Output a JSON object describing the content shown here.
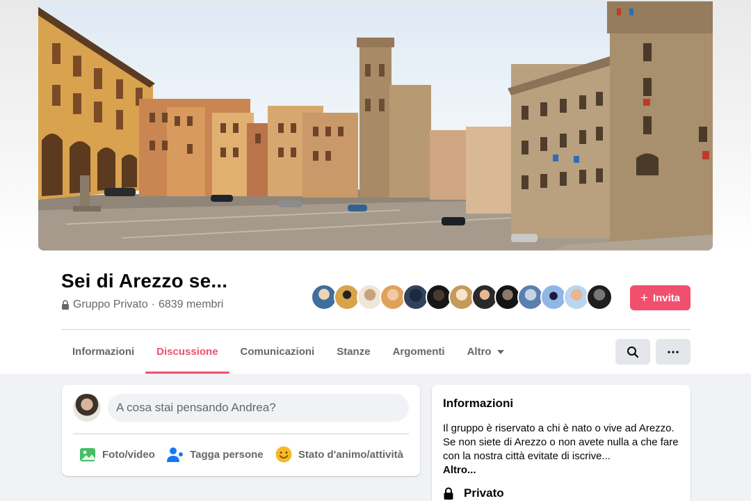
{
  "group": {
    "name": "Sei di Arezzo se...",
    "privacy": "Gruppo Privato",
    "separator": " · ",
    "members": "6839 membri"
  },
  "invite_button": {
    "plus": "+",
    "label": "Invita"
  },
  "tabs": [
    {
      "label": "Informazioni",
      "active": false
    },
    {
      "label": "Discussione",
      "active": true
    },
    {
      "label": "Comunicazioni",
      "active": false
    },
    {
      "label": "Stanze",
      "active": false
    },
    {
      "label": "Argomenti",
      "active": false
    },
    {
      "label": "Altro",
      "active": false
    }
  ],
  "toolbar": {
    "search_icon": "search-icon",
    "more_icon": "more-icon",
    "more_label": "···"
  },
  "composer": {
    "placeholder": "A cosa stai pensando Andrea?",
    "actions": [
      {
        "label": "Foto/video",
        "icon": "photo-icon",
        "color": "#45bd62"
      },
      {
        "label": "Tagga persone",
        "icon": "tag-people-icon",
        "color": "#1877f2"
      },
      {
        "label": "Stato d'animo/attività",
        "icon": "feeling-icon",
        "color": "#f7b928"
      }
    ]
  },
  "about": {
    "title": "Informazioni",
    "description": "Il gruppo è riservato a chi è nato o vive ad Arezzo. Se non siete di Arezzo o non avete nulla a che fare con la nostra città evitate di iscrive...",
    "more": "Altro...",
    "privacy_label": "Privato"
  },
  "colors": {
    "accent": "#f0506e",
    "muted": "#65676b",
    "page_bg": "#f0f2f5"
  },
  "member_avatar_count": 13
}
